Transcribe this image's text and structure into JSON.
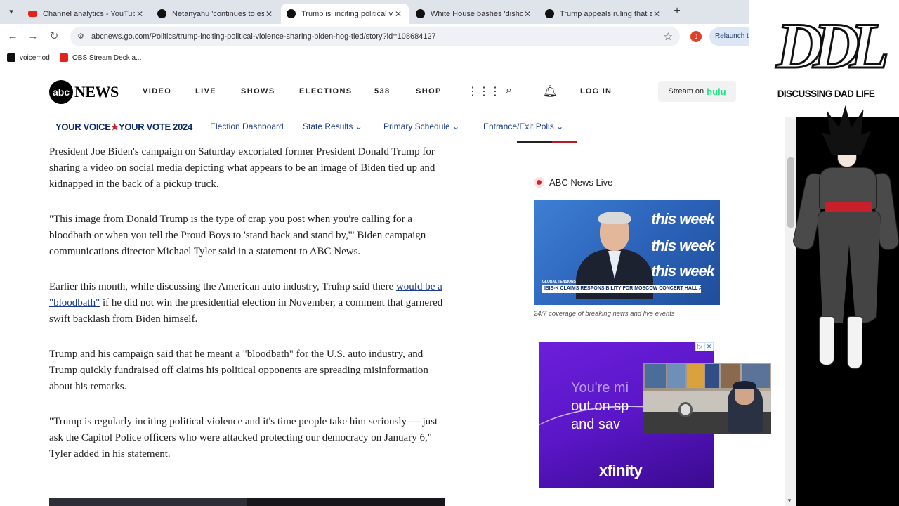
{
  "browser": {
    "tabs": [
      {
        "title": "Channel analytics - YouTube",
        "favicon": "youtube-icon",
        "active": false
      },
      {
        "title": "Netanyahu 'continues to esc",
        "favicon": "abc-icon",
        "active": false
      },
      {
        "title": "Trump is 'inciting political vio",
        "favicon": "abc-icon",
        "active": true
      },
      {
        "title": "White House bashes 'dishon",
        "favicon": "abc-icon",
        "active": false
      },
      {
        "title": "Trump appeals ruling that al",
        "favicon": "abc-icon",
        "active": false
      }
    ],
    "url": "abcnews.go.com/Politics/trump-inciting-political-violence-sharing-biden-hog-tied/story?id=108684127",
    "profile_initial": "J",
    "relaunch_label": "Relaunch to",
    "bookmarks": [
      {
        "label": "voicemod",
        "icon": "voicemod-icon"
      },
      {
        "label": "OBS Stream Deck a...",
        "icon": "youtube-icon"
      }
    ]
  },
  "site": {
    "logo_ball": "abc",
    "logo_text": "NEWS",
    "nav": [
      "VIDEO",
      "LIVE",
      "SHOWS",
      "ELECTIONS",
      "538",
      "SHOP"
    ],
    "login": "LOG IN",
    "stream_prefix": "Stream on",
    "stream_brand": "hulu",
    "subnav": {
      "brand_left": "YOUR VOICE",
      "brand_star": "★",
      "brand_right": "YOUR VOTE 2024",
      "items": [
        "Election Dashboard",
        "State Results",
        "Primary Schedule",
        "Entrance/Exit Polls"
      ]
    }
  },
  "article": {
    "p1": "President Joe Biden's campaign on Saturday excoriated former President Donald Trump for sharing a video on social media depicting what appears to be an image of Biden tied up and kidnapped in the back of a pickup truck.",
    "p2": "\"This image from Donald Trump is the type of crap you post when you're calling for a bloodbath or when you tell the Proud Boys to 'stand back and stand by,'\" Biden campaign communications director Michael Tyler said in a statement to ABC News.",
    "p3_before": "Earlier this month, while discussing the American auto industry, Trump said there ",
    "p3_link": "would be a \"bloodbath\"",
    "p3_after": " if he did not win the presidential election in November, a comment that garnered swift backlash from Biden himself.",
    "p4": "Trump and his campaign said that he meant a \"bloodbath\" for the U.S. auto industry, and Trump quickly fundraised off claims his political opponents are spreading misinformation about his remarks.",
    "p5": "\"Trump is regularly inciting political violence and it's time people take him seriously — just ask the Capitol Police officers who were attacked protecting our democracy on January 6,\" Tyler added in his statement."
  },
  "sidebar": {
    "live_label": "ABC News Live",
    "live_caption": "24/7 coverage of breaking news and live events",
    "thumb_tag": "GLOBAL TENSIONS",
    "thumb_lower_third": "ISIS-K CLAIMS RESPONSIBILITY FOR MOSCOW CONCERT HALL ATTACK",
    "thumb_watermarks": [
      "this week",
      "this week",
      "this week"
    ],
    "ad_line1": "You're mi",
    "ad_line2": "out on sp",
    "ad_line3": "and sav",
    "ad_brand": "xfinity"
  },
  "stream_overlay": {
    "brand_text": "DISCUSSING DAD LIFE",
    "brand_mark": "DDL"
  }
}
